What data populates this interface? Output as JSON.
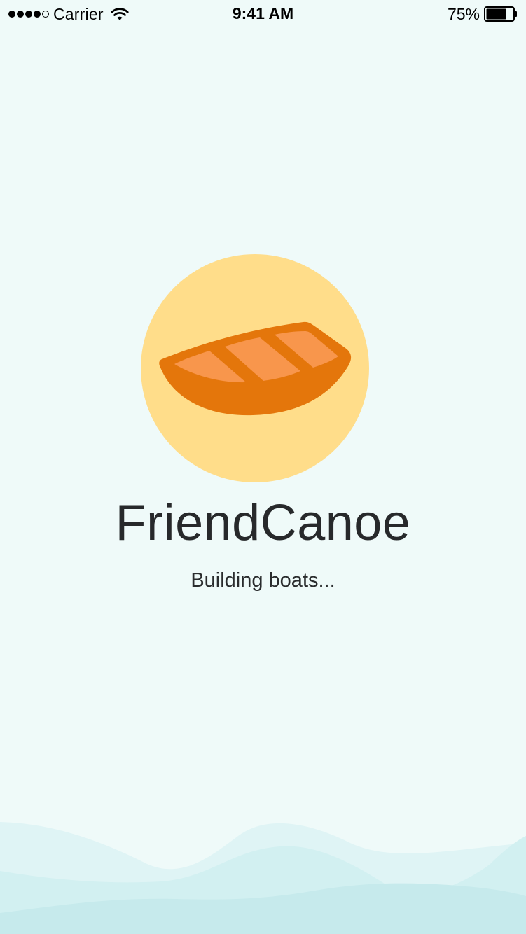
{
  "status_bar": {
    "carrier": "Carrier",
    "time": "9:41 AM",
    "battery_percent": "75%",
    "signal_strength": 4,
    "signal_max": 5,
    "battery_level": 0.75,
    "icons": [
      "wifi-icon",
      "battery-icon"
    ]
  },
  "splash": {
    "app_name": "FriendCanoe",
    "loading_message": "Building boats...",
    "logo_icon": "canoe-icon"
  },
  "colors": {
    "background": "#effaf9",
    "logo_circle": "#ffdd8a",
    "canoe_hull": "#e4760b",
    "canoe_inner": "#f8964c",
    "title_text": "#27292b",
    "wave_light": "#dff4f5",
    "wave_mid": "#d2f0f1",
    "wave_dark": "#c6eaec"
  }
}
